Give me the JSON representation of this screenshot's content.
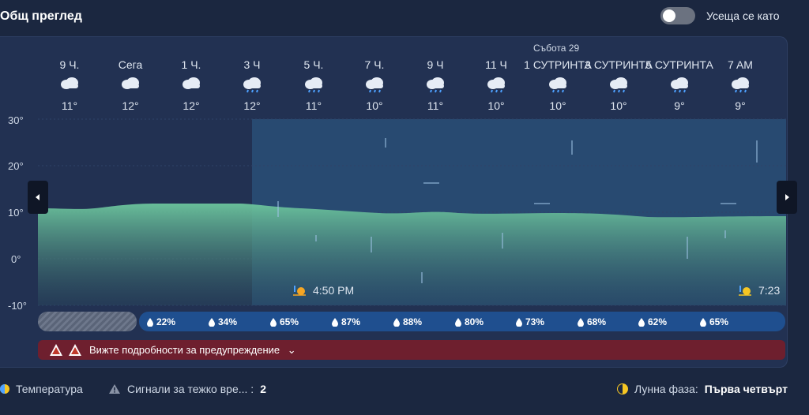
{
  "header": {
    "title": "Общ преглед",
    "feels_like_label": "Усеща се като"
  },
  "day_label": "Събота 29",
  "hours": [
    {
      "time": "9 Ч.",
      "temp": "11°",
      "icon": "cloud-icon"
    },
    {
      "time": "Сега",
      "temp": "12°",
      "icon": "cloud-icon"
    },
    {
      "time": "1 Ч.",
      "temp": "12°",
      "icon": "cloud-icon"
    },
    {
      "time": "3 Ч",
      "temp": "12°",
      "icon": "rain-cloud-icon"
    },
    {
      "time": "5 Ч.",
      "temp": "11°",
      "icon": "rain-cloud-icon"
    },
    {
      "time": "7 Ч.",
      "temp": "10°",
      "icon": "rain-cloud-icon"
    },
    {
      "time": "9 Ч",
      "temp": "11°",
      "icon": "rain-cloud-icon"
    },
    {
      "time": "11 Ч",
      "temp": "10°",
      "icon": "rain-cloud-icon"
    },
    {
      "time": "1 СУТРИНТА",
      "temp": "10°",
      "icon": "rain-cloud-icon"
    },
    {
      "time": "3 СУТРИНТА",
      "temp": "10°",
      "icon": "rain-cloud-icon"
    },
    {
      "time": "5 СУТРИНТА",
      "temp": "9°",
      "icon": "rain-cloud-icon"
    },
    {
      "time": "7 AM",
      "temp": "9°",
      "icon": "rain-cloud-icon"
    }
  ],
  "y_axis": [
    "30°",
    "20°",
    "10°",
    "0°",
    "-10°"
  ],
  "sunset": {
    "time": "4:50 PM",
    "icon": "sunset-icon"
  },
  "sunrise": {
    "time": "7:23",
    "icon": "sunrise-icon"
  },
  "precipitation": [
    "22%",
    "34%",
    "65%",
    "87%",
    "88%",
    "80%",
    "73%",
    "68%",
    "62%",
    "65%"
  ],
  "warning": {
    "text": "Вижте подробности за предупреждение",
    "icon": "hazard-icon"
  },
  "legend": {
    "temperature": "Температура",
    "alerts_label": "Сигнали за тежко вре... :",
    "alerts_count": "2",
    "moon_label": "Лунна фаза:",
    "moon_value": "Първа четвърт"
  },
  "colors": {
    "area_fill": "#5fa88f",
    "rain_zone": "#2e5f8a",
    "warning": "#6e1f2e",
    "precip_bar": "#1f4f8f"
  }
}
